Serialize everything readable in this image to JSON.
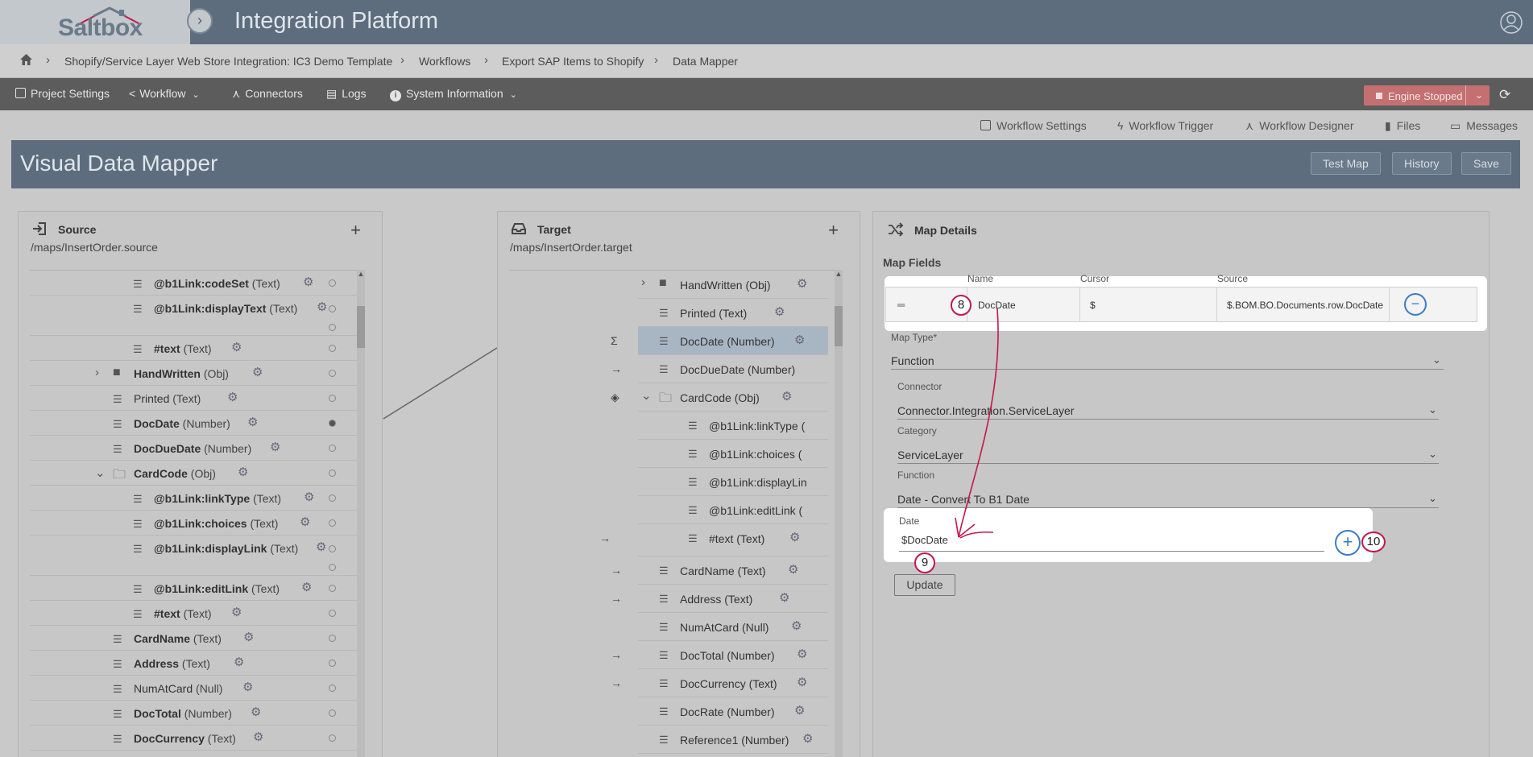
{
  "app": {
    "logo_text": "Saltbox",
    "title": "Integration Platform"
  },
  "breadcrumb": [
    "Shopify/Service Layer Web Store Integration: IC3 Demo Template",
    "Workflows",
    "Export SAP Items to Shopify",
    "Data Mapper"
  ],
  "menu": {
    "project_settings": "Project Settings",
    "workflow": "Workflow",
    "connectors": "Connectors",
    "logs": "Logs",
    "system_information": "System Information",
    "engine_status": "Engine Stopped"
  },
  "subtoolbar": {
    "workflow_settings": "Workflow Settings",
    "workflow_trigger": "Workflow Trigger",
    "workflow_designer": "Workflow Designer",
    "files": "Files",
    "messages": "Messages"
  },
  "mapper": {
    "title": "Visual Data Mapper",
    "test_map": "Test Map",
    "history": "History",
    "save": "Save"
  },
  "source": {
    "title": "Source",
    "path": "/maps/InsertOrder.source",
    "rows": [
      {
        "name": "@b1Link:codeSet",
        "type": "(Text)"
      },
      {
        "name": "@b1Link:displayText",
        "type": "(Text)"
      },
      {
        "name": "#text",
        "type": "(Text)"
      },
      {
        "name": "HandWritten",
        "type": "(Obj)"
      },
      {
        "name": "Printed",
        "type": "(Text)"
      },
      {
        "name": "DocDate",
        "type": "(Number)"
      },
      {
        "name": "DocDueDate",
        "type": "(Number)"
      },
      {
        "name": "CardCode",
        "type": "(Obj)"
      },
      {
        "name": "@b1Link:linkType",
        "type": "(Text)"
      },
      {
        "name": "@b1Link:choices",
        "type": "(Text)"
      },
      {
        "name": "@b1Link:displayLink",
        "type": "(Text)"
      },
      {
        "name": "@b1Link:editLink",
        "type": "(Text)"
      },
      {
        "name": "#text",
        "type": "(Text)"
      },
      {
        "name": "CardName",
        "type": "(Text)"
      },
      {
        "name": "Address",
        "type": "(Text)"
      },
      {
        "name": "NumAtCard",
        "type": "(Null)"
      },
      {
        "name": "DocTotal",
        "type": "(Number)"
      },
      {
        "name": "DocCurrency",
        "type": "(Text)"
      }
    ]
  },
  "target": {
    "title": "Target",
    "path": "/maps/InsertOrder.target",
    "rows": [
      {
        "name": "HandWritten",
        "type": "(Obj)"
      },
      {
        "name": "Printed",
        "type": "(Text)"
      },
      {
        "name": "DocDate",
        "type": "(Number)"
      },
      {
        "name": "DocDueDate",
        "type": "(Number)"
      },
      {
        "name": "CardCode",
        "type": "(Obj)"
      },
      {
        "name": "@b1Link:linkType",
        "type": "("
      },
      {
        "name": "@b1Link:choices",
        "type": "("
      },
      {
        "name": "@b1Link:displayLin",
        "type": ""
      },
      {
        "name": "@b1Link:editLink",
        "type": "("
      },
      {
        "name": "#text",
        "type": "(Text)"
      },
      {
        "name": "CardName",
        "type": "(Text)"
      },
      {
        "name": "Address",
        "type": "(Text)"
      },
      {
        "name": "NumAtCard",
        "type": "(Null)"
      },
      {
        "name": "DocTotal",
        "type": "(Number)"
      },
      {
        "name": "DocCurrency",
        "type": "(Text)"
      },
      {
        "name": "DocRate",
        "type": "(Number)"
      },
      {
        "name": "Reference1",
        "type": "(Number)"
      }
    ]
  },
  "map_details": {
    "title": "Map Details",
    "fields_label": "Map Fields",
    "col_name": "Name",
    "col_cursor": "Cursor",
    "col_source": "Source",
    "field_name": "DocDate",
    "field_cursor": "$",
    "field_source": "$.BOM.BO.Documents.row.DocDate",
    "map_type_label": "Map Type*",
    "map_type_value": "Function",
    "connector_label": "Connector",
    "connector_value": "Connector.Integration.ServiceLayer",
    "category_label": "Category",
    "category_value": "ServiceLayer",
    "function_label": "Function",
    "function_value": "Date - Convert To B1 Date",
    "date_label": "Date",
    "date_value": "$DocDate",
    "update": "Update"
  },
  "annotations": {
    "step8": "8",
    "step9": "9",
    "step10": "10"
  },
  "colors": {
    "header": "#5d6d7e",
    "menubar": "#5c5c5c",
    "engine": "#c47070",
    "accent": "#3b7dc4",
    "annotation": "#c2184b"
  }
}
